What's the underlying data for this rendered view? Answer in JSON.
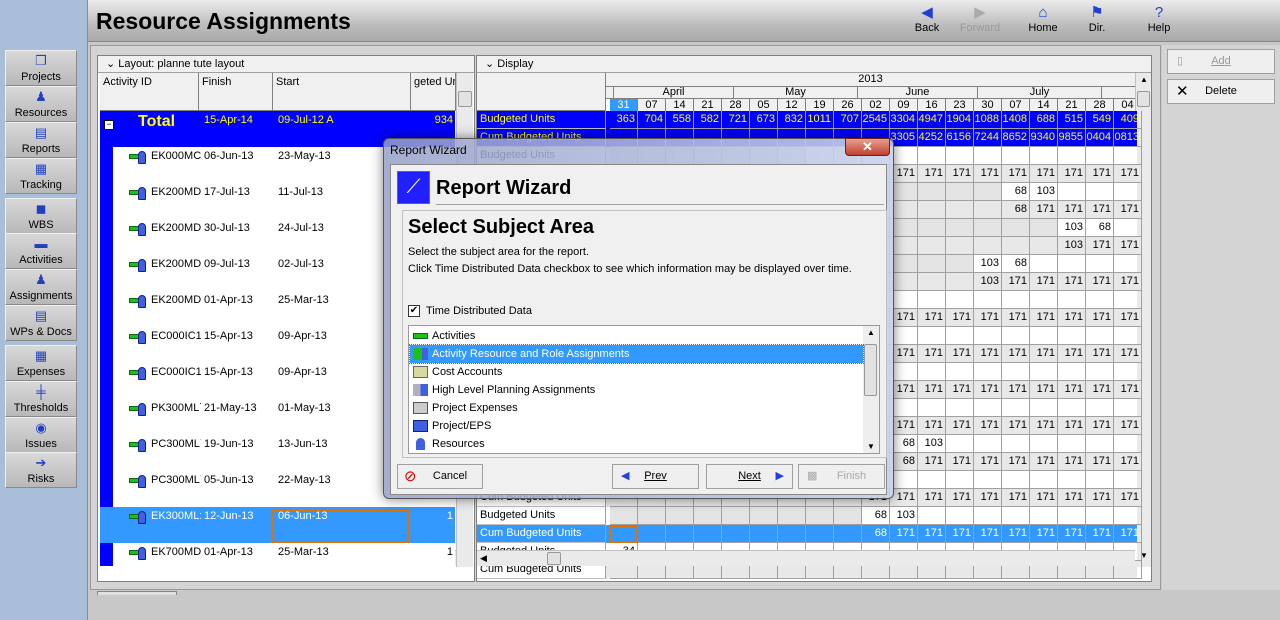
{
  "header": {
    "title": "Resource Assignments",
    "nav": [
      {
        "label": "Back",
        "icon": "back-arrow-icon",
        "enabled": true
      },
      {
        "label": "Forward",
        "icon": "forward-arrow-icon",
        "enabled": false
      },
      {
        "label": "Home",
        "icon": "home-icon",
        "enabled": true
      },
      {
        "label": "Dir.",
        "icon": "signpost-icon",
        "enabled": true
      },
      {
        "label": "Help",
        "icon": "help-icon",
        "enabled": true
      }
    ]
  },
  "sidebar": {
    "items": [
      {
        "label": "Projects",
        "icon": "projects-icon",
        "glyph": "❐"
      },
      {
        "label": "Resources",
        "icon": "resource-person-icon",
        "glyph": "♟"
      },
      {
        "label": "Reports",
        "icon": "reports-icon",
        "glyph": "▤"
      },
      {
        "label": "Tracking",
        "icon": "tracking-chart-icon",
        "glyph": "▦"
      },
      {
        "label": "WBS",
        "icon": "wbs-icon",
        "glyph": "◼"
      },
      {
        "label": "Activities",
        "icon": "activity-bar-icon",
        "glyph": "▬"
      },
      {
        "label": "Assignments",
        "icon": "assignment-icon",
        "glyph": "♟"
      },
      {
        "label": "WPs & Docs",
        "icon": "document-icon",
        "glyph": "▤"
      },
      {
        "label": "Expenses",
        "icon": "calculator-icon",
        "glyph": "▦"
      },
      {
        "label": "Thresholds",
        "icon": "threshold-icon",
        "glyph": "╪"
      },
      {
        "label": "Issues",
        "icon": "issues-icon",
        "glyph": "◉"
      },
      {
        "label": "Risks",
        "icon": "risks-icon",
        "glyph": "➔"
      }
    ]
  },
  "actions": {
    "add": "Add",
    "delete": "Delete"
  },
  "left_panel": {
    "layout_label": "Layout: planne tute layout",
    "columns": [
      "Activity ID",
      "Finish",
      "Start",
      "geted Un"
    ],
    "total": {
      "label": "Total",
      "finish": "15-Apr-14",
      "start": "09-Jul-12 A",
      "units": "934"
    },
    "rows": [
      {
        "id": "EK000MC:",
        "finish": "06-Jun-13",
        "start": "23-May-13",
        "units": ""
      },
      {
        "id": "EK200MD",
        "finish": "17-Jul-13",
        "start": "11-Jul-13",
        "units": ""
      },
      {
        "id": "EK200MD",
        "finish": "30-Jul-13",
        "start": "24-Jul-13",
        "units": ""
      },
      {
        "id": "EK200MD",
        "finish": "09-Jul-13",
        "start": "02-Jul-13",
        "units": ""
      },
      {
        "id": "EK200MD",
        "finish": "01-Apr-13",
        "start": "25-Mar-13",
        "units": ""
      },
      {
        "id": "EC000IC1:",
        "finish": "15-Apr-13",
        "start": "09-Apr-13",
        "units": ""
      },
      {
        "id": "EC000IC1·",
        "finish": "15-Apr-13",
        "start": "09-Apr-13",
        "units": ""
      },
      {
        "id": "PK300ML˙",
        "finish": "21-May-13",
        "start": "01-May-13",
        "units": ""
      },
      {
        "id": "PC300ML˙",
        "finish": "19-Jun-13",
        "start": "13-Jun-13",
        "units": ""
      },
      {
        "id": "PC300ML˙",
        "finish": "05-Jun-13",
        "start": "22-May-13",
        "units": ""
      },
      {
        "id": "EK300ML:",
        "finish": "12-Jun-13",
        "start": "06-Jun-13",
        "units": "1",
        "selected": true
      },
      {
        "id": "EK700MD",
        "finish": "01-Apr-13",
        "start": "25-Mar-13",
        "units": "1"
      }
    ]
  },
  "right_panel": {
    "display_label": "Display",
    "year": "2013",
    "months": [
      "April",
      "May",
      "June",
      "July"
    ],
    "weeks": [
      "31",
      "07",
      "14",
      "21",
      "28",
      "05",
      "12",
      "19",
      "26",
      "02",
      "09",
      "16",
      "23",
      "30",
      "07",
      "14",
      "21",
      "28",
      "04"
    ],
    "current_week": "31",
    "labels": {
      "budgeted": "Budgeted Units",
      "cum": "Cum Budgeted Units"
    },
    "total": {
      "budgeted": [
        "363",
        "704",
        "558",
        "582",
        "721",
        "673",
        "832",
        "1011",
        "707",
        "2545",
        "3304",
        "4947",
        "1904",
        "1088",
        "1408",
        "688",
        "515",
        "549",
        "409"
      ],
      "cum": [
        "",
        "",
        "",
        "",
        "",
        "",
        "",
        "",
        "",
        "",
        "3305",
        "4252",
        "6156",
        "7244",
        "8652",
        "9340",
        "9855",
        "0404",
        "0813"
      ]
    },
    "rows": [
      {
        "start_week_index": 7,
        "budgeted": [
          "",
          "",
          "",
          "",
          "",
          "",
          "",
          "",
          "",
          "",
          "",
          "",
          "",
          "",
          "",
          "",
          "",
          "",
          ""
        ],
        "cum": [
          "",
          "",
          "",
          "",
          "",
          "",
          "",
          "",
          "",
          "",
          "171",
          "171",
          "171",
          "171",
          "171",
          "171",
          "171",
          "171",
          "171"
        ]
      },
      {
        "start_week_index": 14,
        "budgeted": [
          "",
          "",
          "",
          "",
          "",
          "",
          "",
          "",
          "",
          "",
          "",
          "",
          "",
          "",
          "68",
          "103",
          "",
          "",
          ""
        ],
        "cum": [
          "",
          "",
          "",
          "",
          "",
          "",
          "",
          "",
          "",
          "",
          "",
          "",
          "",
          "",
          "68",
          "171",
          "171",
          "171",
          "171"
        ]
      },
      {
        "start_week_index": 16,
        "budgeted": [
          "",
          "",
          "",
          "",
          "",
          "",
          "",
          "",
          "",
          "",
          "",
          "",
          "",
          "",
          "",
          "",
          "103",
          "68",
          ""
        ],
        "cum": [
          "",
          "",
          "",
          "",
          "",
          "",
          "",
          "",
          "",
          "",
          "",
          "",
          "",
          "",
          "",
          "",
          "103",
          "171",
          "171"
        ]
      },
      {
        "start_week_index": 13,
        "budgeted": [
          "",
          "",
          "",
          "",
          "",
          "",
          "",
          "",
          "",
          "",
          "",
          "",
          "",
          "103",
          "68",
          "",
          "",
          "",
          ""
        ],
        "cum": [
          "",
          "",
          "",
          "",
          "",
          "",
          "",
          "",
          "",
          "",
          "",
          "",
          "",
          "103",
          "171",
          "171",
          "171",
          "171",
          "171"
        ]
      },
      {
        "start_week_index": 0,
        "budgeted": [
          "",
          "",
          "",
          "",
          "",
          "",
          "",
          "",
          "",
          "",
          "",
          "",
          "",
          "",
          "",
          "",
          "",
          "",
          ""
        ],
        "cum": [
          "",
          "",
          "",
          "",
          "",
          "",
          "",
          "",
          "",
          "",
          "171",
          "171",
          "171",
          "171",
          "171",
          "171",
          "171",
          "171",
          "171"
        ]
      },
      {
        "start_week_index": 0,
        "budgeted": [
          "",
          "",
          "",
          "",
          "",
          "",
          "",
          "",
          "",
          "",
          "",
          "",
          "",
          "",
          "",
          "",
          "",
          "",
          ""
        ],
        "cum": [
          "",
          "",
          "",
          "",
          "",
          "",
          "",
          "",
          "",
          "",
          "171",
          "171",
          "171",
          "171",
          "171",
          "171",
          "171",
          "171",
          "171"
        ]
      },
      {
        "start_week_index": 0,
        "budgeted": [
          "",
          "",
          "",
          "",
          "",
          "",
          "",
          "",
          "",
          "",
          "",
          "",
          "",
          "",
          "",
          "",
          "",
          "",
          ""
        ],
        "cum": [
          "",
          "",
          "",
          "",
          "",
          "",
          "",
          "",
          "",
          "",
          "171",
          "171",
          "171",
          "171",
          "171",
          "171",
          "171",
          "171",
          "171"
        ]
      },
      {
        "start_week_index": 0,
        "budgeted": [
          "",
          "",
          "",
          "",
          "",
          "",
          "",
          "",
          "",
          "",
          "",
          "",
          "",
          "",
          "",
          "",
          "",
          "",
          ""
        ],
        "cum": [
          "",
          "",
          "",
          "",
          "",
          "",
          "",
          "",
          "",
          "",
          "171",
          "171",
          "171",
          "171",
          "171",
          "171",
          "171",
          "171",
          "171"
        ]
      },
      {
        "start_week_index": 10,
        "budgeted": [
          "",
          "",
          "",
          "",
          "",
          "",
          "",
          "",
          "",
          "",
          "68",
          "103",
          "",
          "",
          "",
          "",
          "",
          "",
          ""
        ],
        "cum": [
          "",
          "",
          "",
          "",
          "",
          "",
          "",
          "",
          "",
          "",
          "68",
          "171",
          "171",
          "171",
          "171",
          "171",
          "171",
          "171",
          "171"
        ]
      },
      {
        "start_week_index": 7,
        "budgeted": [
          "",
          "",
          "",
          "",
          "",
          "",
          "",
          "",
          "",
          "",
          "",
          "",
          "",
          "",
          "",
          "",
          "",
          "",
          ""
        ],
        "cum": [
          "",
          "",
          "",
          "",
          "",
          "",
          "",
          "",
          "",
          "171",
          "171",
          "171",
          "171",
          "171",
          "171",
          "171",
          "171",
          "171",
          "171"
        ]
      },
      {
        "start_week_index": 9,
        "budgeted": [
          "",
          "",
          "",
          "",
          "",
          "",
          "",
          "",
          "",
          "68",
          "103",
          "",
          "",
          "",
          "",
          "",
          "",
          "",
          ""
        ],
        "cum": [
          "",
          "",
          "",
          "",
          "",
          "",
          "",
          "",
          "",
          "68",
          "171",
          "171",
          "171",
          "171",
          "171",
          "171",
          "171",
          "171",
          "171"
        ],
        "selected_row": "cum"
      },
      {
        "start_week_index": 0,
        "budgeted": [
          "34",
          "",
          "",
          "",
          "",
          "",
          "",
          "",
          "",
          "",
          "",
          "",
          "",
          "",
          "",
          "",
          "",
          "",
          ""
        ],
        "cum": [
          "",
          "",
          "",
          "",
          "",
          "",
          "",
          "",
          "",
          "",
          "",
          "",
          "",
          "",
          "",
          "",
          "",
          "",
          ""
        ]
      }
    ]
  },
  "dialog": {
    "window_title": "Report Wizard",
    "heading": "Report Wizard",
    "subheading": "Select Subject Area",
    "line1": "Select the subject area for the report.",
    "line2": "Click Time Distributed Data checkbox to see which information may be displayed over time.",
    "checkbox_label": "Time Distributed Data",
    "checkbox_checked": true,
    "items": [
      {
        "label": "Activities",
        "icon": "activity-bar-icon"
      },
      {
        "label": "Activity Resource and Role Assignments",
        "icon": "assignment-icon",
        "selected": true
      },
      {
        "label": "Cost Accounts",
        "icon": "cost-accounts-icon"
      },
      {
        "label": "High Level Planning Assignments",
        "icon": "planning-assignment-icon"
      },
      {
        "label": "Project Expenses",
        "icon": "calculator-icon"
      },
      {
        "label": "Project/EPS",
        "icon": "eps-icon"
      },
      {
        "label": "Resources",
        "icon": "resource-person-icon"
      }
    ],
    "buttons": {
      "cancel": "Cancel",
      "prev": "Prev",
      "next": "Next",
      "finish": "Finish"
    }
  },
  "colors": {
    "total_bg": "#0000ff",
    "total_text": "#ffff00",
    "selection": "#3399ff",
    "focus": "#e07000"
  }
}
